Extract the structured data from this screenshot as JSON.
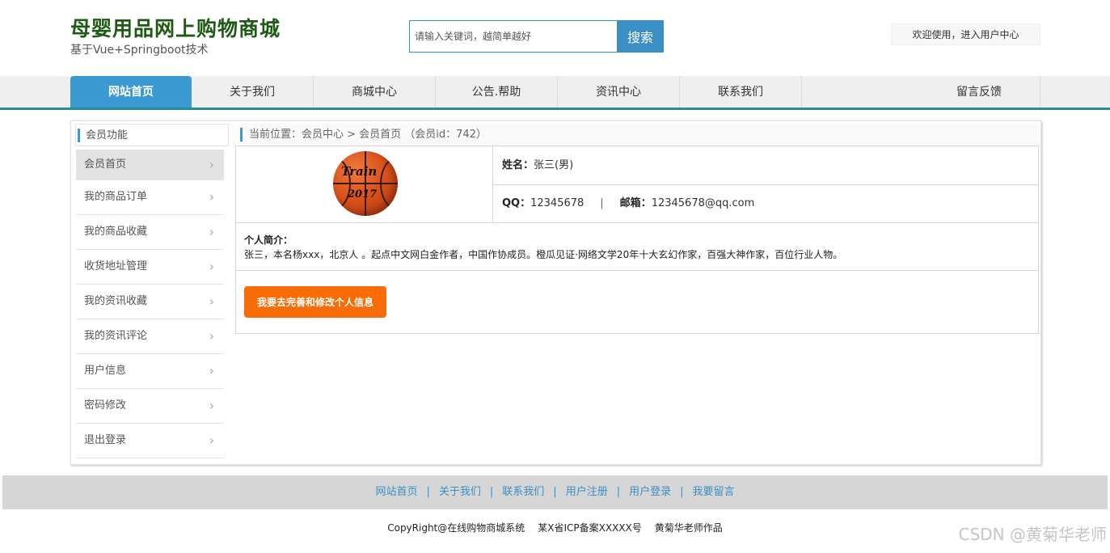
{
  "header": {
    "site_title": "母婴用品网上购物商城",
    "site_subtitle": "基于Vue+Springboot技术",
    "search_placeholder": "请输入关键词，越简单越好",
    "search_button": "搜索",
    "welcome_text": "欢迎使用，进入用户中心"
  },
  "nav": {
    "items": [
      "网站首页",
      "关于我们",
      "商城中心",
      "公告.帮助",
      "资讯中心",
      "联系我们",
      "留言反馈"
    ],
    "active": "网站首页"
  },
  "sidebar": {
    "title": "会员功能",
    "items": [
      "会员首页",
      "我的商品订单",
      "我的商品收藏",
      "收货地址管理",
      "我的资讯收藏",
      "我的资讯评论",
      "用户信息",
      "密码修改",
      "退出登录"
    ],
    "active": "会员首页"
  },
  "breadcrumb": "当前位置：会员中心 > 会员首页 （会员id：742）",
  "profile": {
    "avatar_brand": "Train",
    "avatar_year": "2017",
    "name_label": "姓名：",
    "name_value": "张三(男)",
    "qq_label": "QQ：",
    "qq_value": "12345678",
    "separator": "|",
    "email_label": "邮箱：",
    "email_value": "12345678@qq.com",
    "intro_label": "个人简介：",
    "intro_text": "张三，本名杨xxx，北京人 。起点中文网白金作者，中国作协成员。橙瓜见证·网络文学20年十大玄幻作家，百强大神作家，百位行业人物。",
    "edit_button": "我要去完善和修改个人信息"
  },
  "footer": {
    "links": [
      "网站首页",
      "关于我们",
      "联系我们",
      "用户注册",
      "用户登录",
      "我要留言"
    ],
    "link_separator": "|",
    "copyright": "CopyRight@在线购物商城系统",
    "icp": "某X省ICP备案XXXXX号",
    "author": "黄菊华老师作品"
  },
  "watermark": "CSDN @黄菊华老师",
  "colors": {
    "brand_green": "#1f5a14",
    "accent_blue": "#3a9ad1",
    "nav_underline": "#2a8c96",
    "action_orange": "#f76c06"
  },
  "icons": {
    "sidebar_arrow": "chevron-right-icon"
  }
}
